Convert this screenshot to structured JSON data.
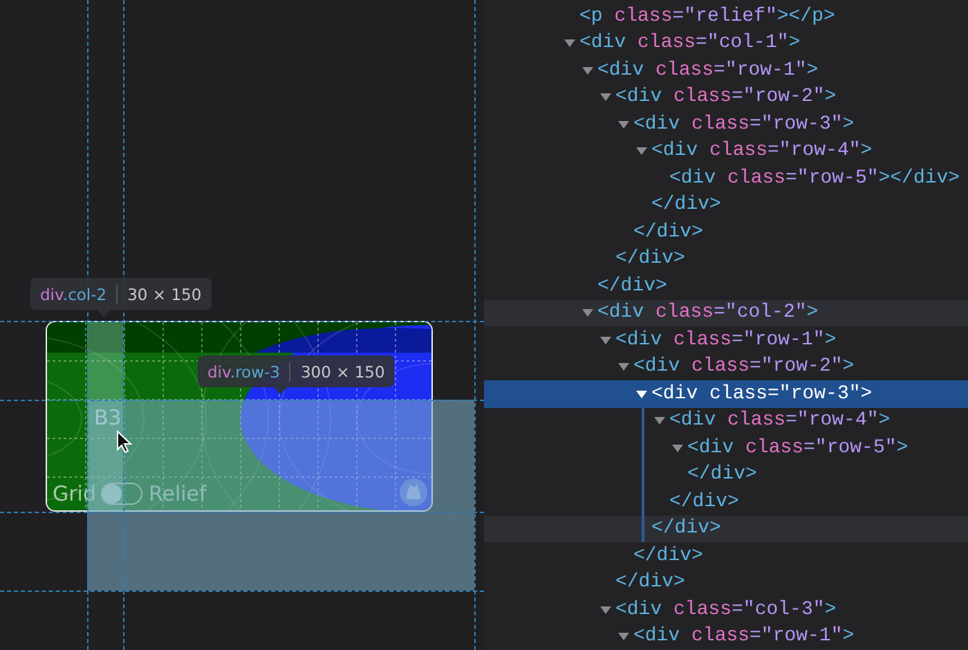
{
  "canvas": {
    "tooltips": [
      {
        "element": "div.col-2",
        "size": "30 × 150"
      },
      {
        "element": "div.row-3",
        "size": "300 × 150"
      }
    ],
    "card": {
      "cell_label": "B3",
      "toggle": {
        "left_label": "Grid",
        "right_label": "Relief",
        "on": false
      }
    }
  },
  "dom_tree": [
    {
      "open": "<p class=\"relief\"></p>",
      "selected": false
    },
    {
      "open": "<div class=\"col-1\">",
      "expanded": true,
      "selected": false,
      "children": [
        {
          "open": "<div class=\"row-1\">",
          "close": "</div>",
          "expanded": true,
          "selected": false,
          "children": [
            {
              "open": "<div class=\"row-2\">",
              "close": "</div>",
              "expanded": true,
              "selected": false,
              "children": [
                {
                  "open": "<div class=\"row-3\">",
                  "close": "</div>",
                  "expanded": true,
                  "selected": false,
                  "children": [
                    {
                      "open": "<div class=\"row-4\">",
                      "close": "</div>",
                      "expanded": true,
                      "selected": false,
                      "children": [
                        {
                          "open": "<div class=\"row-5\"></div>",
                          "selected": false
                        }
                      ]
                    }
                  ]
                }
              ]
            }
          ]
        },
        {
          "open": "<div class=\"col-2\">",
          "expanded": true,
          "selected": false,
          "hovered": true,
          "children": [
            {
              "open": "<div class=\"row-1\">",
              "close": "</div>",
              "expanded": true,
              "selected": false,
              "children": [
                {
                  "open": "<div class=\"row-2\">",
                  "close": "</div>",
                  "expanded": true,
                  "selected": false,
                  "children": [
                    {
                      "open": "<div class=\"row-3\">",
                      "close": "</div>",
                      "expanded": true,
                      "selected": true,
                      "close_hovered": true,
                      "children": [
                        {
                          "open": "<div class=\"row-4\">",
                          "close": "</div>",
                          "expanded": true,
                          "selected": false,
                          "children": [
                            {
                              "open": "<div class=\"row-5\">",
                              "close": "</div>",
                              "expanded": true,
                              "selected": false
                            }
                          ]
                        }
                      ]
                    }
                  ]
                }
              ]
            },
            {
              "open": "<div class=\"col-3\">",
              "expanded": true,
              "selected": false,
              "children": [
                {
                  "open": "<div class=\"row-1\">",
                  "expanded": true,
                  "selected": false
                }
              ]
            }
          ]
        }
      ]
    }
  ]
}
